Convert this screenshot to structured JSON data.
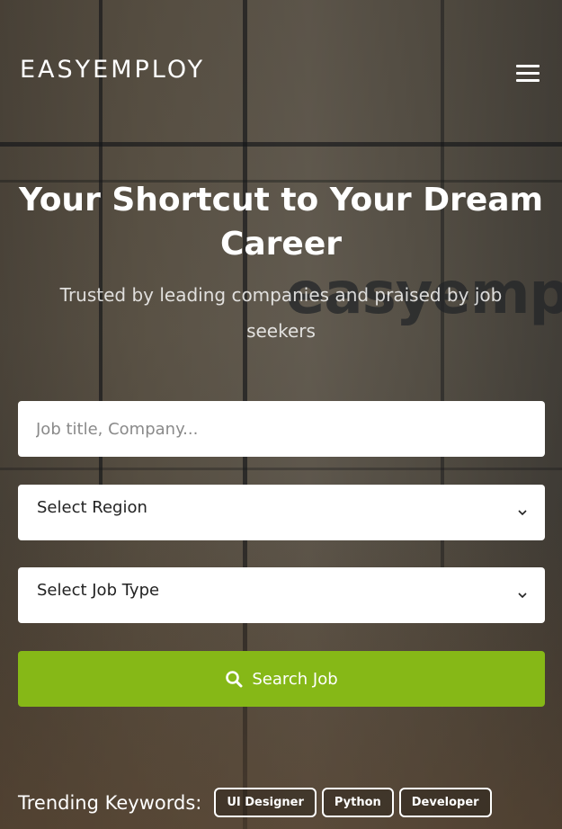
{
  "header": {
    "brand": "EASYEMPLOY",
    "menu_icon": "hamburger-menu-icon"
  },
  "hero": {
    "title": "Your Shortcut to Your Dream Career",
    "subtitle": "Trusted by leading companies and praised by job seekers",
    "background_wall_text": "easyemp"
  },
  "search_form": {
    "keyword_placeholder": "Job title, Company...",
    "region_select": "Select Region",
    "job_type_select": "Select Job Type",
    "submit_label": "Search Job",
    "submit_icon": "search-icon",
    "accent_color": "#86b817"
  },
  "trending": {
    "label": "Trending Keywords:",
    "keywords": [
      "UI Designer",
      "Python",
      "Developer"
    ]
  }
}
